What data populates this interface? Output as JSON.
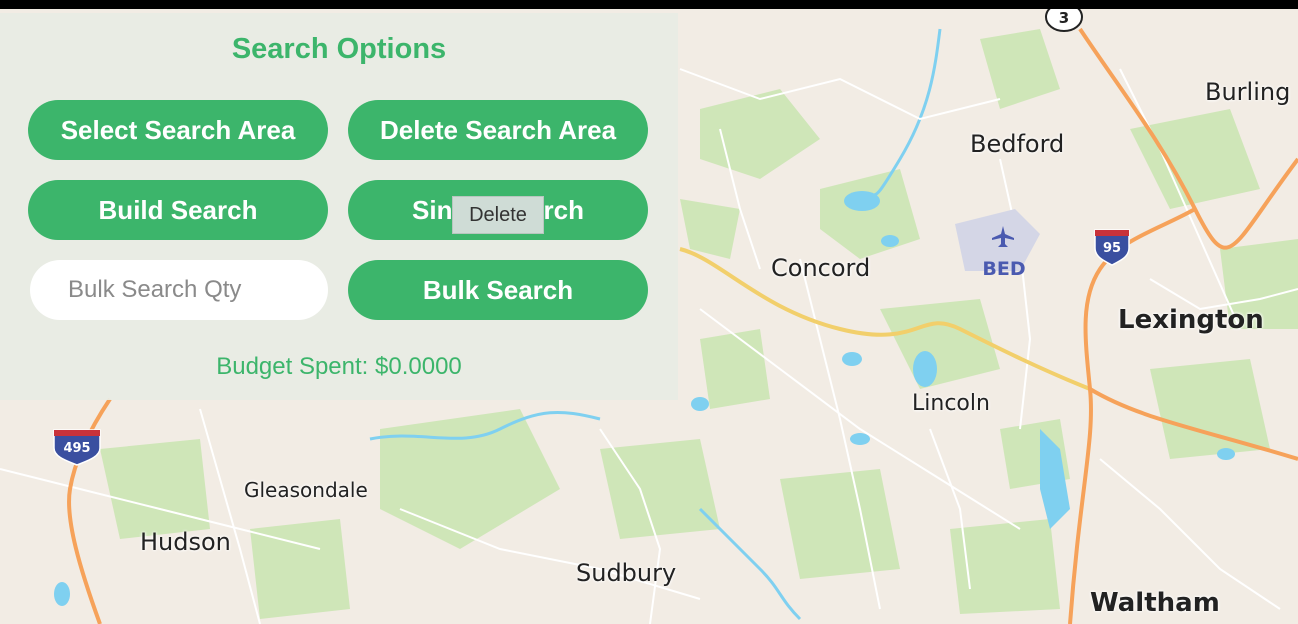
{
  "panel": {
    "title": "Search Options",
    "buttons": {
      "select_area": "Select Search Area",
      "delete_area": "Delete Search Area",
      "build_search": "Build Search",
      "single_search": "Single Search",
      "bulk_search": "Bulk Search"
    },
    "bulk_qty_placeholder": "Bulk Search Qty",
    "budget_text": "Budget Spent: $0.0000"
  },
  "tooltip": {
    "text": "Delete"
  },
  "map": {
    "places": {
      "bedford": "Bedford",
      "concord": "Concord",
      "lexington": "Lexington",
      "lincoln": "Lincoln",
      "gleasondale": "Gleasondale",
      "hudson": "Hudson",
      "sudbury": "Sudbury",
      "waltham": "Waltham",
      "burlington": "Burling"
    },
    "airport_code": "BED",
    "shields": {
      "i95": "95",
      "i495": "495",
      "route3": "3"
    }
  },
  "colors": {
    "accent": "#3cb56b",
    "map_bg": "#f2ece4",
    "park": "#cfe6b8",
    "water": "#7fd0f0",
    "highway": "#f6a25a",
    "major_road": "#f2cf6b",
    "interstate_blue": "#3a4fa0",
    "interstate_red": "#c8323a"
  }
}
